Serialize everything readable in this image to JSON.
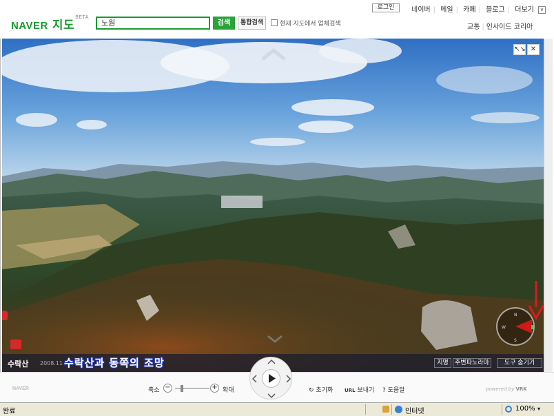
{
  "header": {
    "logo_brand": "NAVER",
    "logo_service": "지도",
    "logo_badge": "BETA",
    "search_value": "노원",
    "search_button": "검색",
    "integrated_search_button": "통합검색",
    "search_current_map_label": "현재 지도에서 업체검색",
    "login_button": "로그인",
    "top_links": [
      "네이버",
      "메일",
      "카페",
      "블로그",
      "더보기"
    ],
    "more_toggle": "v",
    "sub_links": [
      "교통",
      "인사이드 코리아"
    ]
  },
  "panorama": {
    "fullscreen_label": "↖↘",
    "close_label": "✕",
    "place_name": "수락산",
    "date": "2008.11",
    "title": "수락산과 동쪽의 조망",
    "buttons": [
      "지명",
      "주변파노라마",
      "도구 숨기기"
    ],
    "compass_letters": [
      "N",
      "W",
      "E",
      "S"
    ]
  },
  "toolbar": {
    "brand": "NAVER",
    "zoom_out_label": "축소",
    "zoom_in_label": "확대",
    "zoom_out_symbol": "−",
    "zoom_in_symbol": "+",
    "reset_label": "초기화",
    "url_label": "URL",
    "send_label": "보내기",
    "help_label": "? 도움말",
    "powered_by": "powered by"
  },
  "statusbar": {
    "status": "완료",
    "zone": "인터넷",
    "zoom": "100%"
  },
  "colors": {
    "brand_green": "#1a9a2f",
    "caption_outline": "#2238b8",
    "arrow_red": "#e01818"
  }
}
